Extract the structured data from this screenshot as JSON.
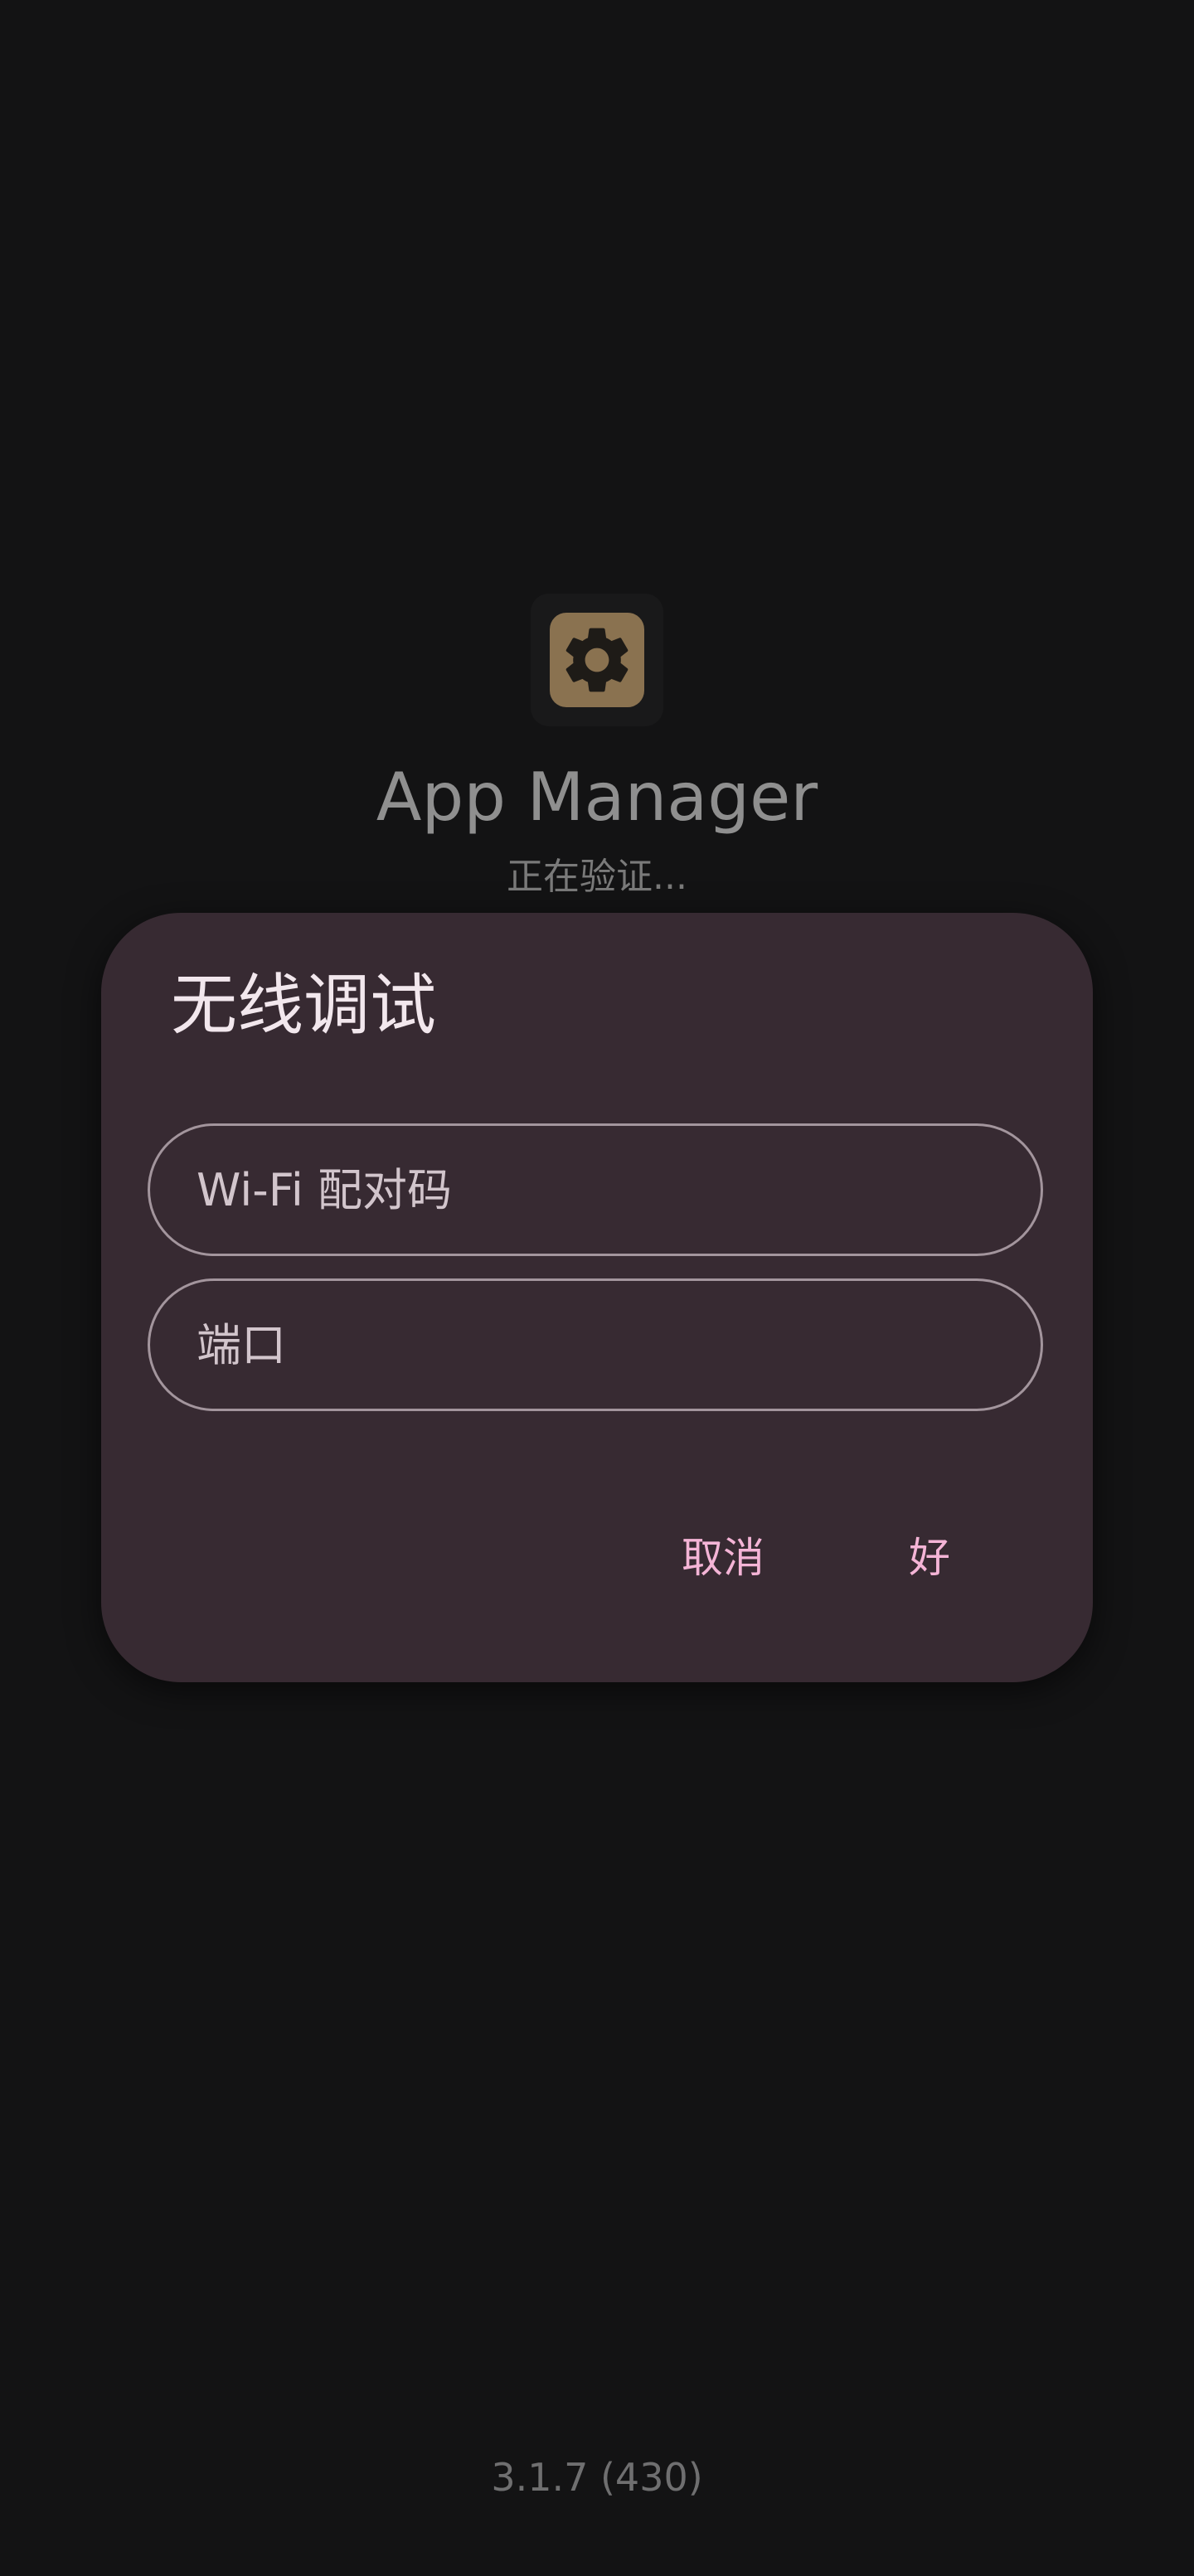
{
  "splash": {
    "app_name": "App Manager",
    "status": "正在验证...",
    "version": "3.1.7 (430)",
    "icon": "gear-icon"
  },
  "dialog": {
    "title": "无线调试",
    "wifi_field": {
      "placeholder": "Wi-Fi 配对码",
      "value": ""
    },
    "port_field": {
      "placeholder": "端口",
      "value": ""
    },
    "cancel_label": "取消",
    "ok_label": "好"
  },
  "colors": {
    "background": "#131314",
    "dialog": "#372a32",
    "accent": "#f4b4d6",
    "icon_bg": "#8a7250"
  }
}
